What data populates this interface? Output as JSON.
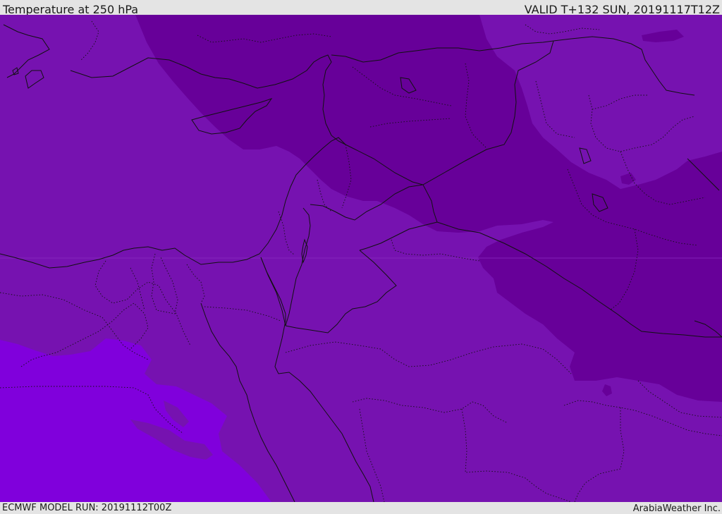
{
  "header": {
    "title": "Temperature at 250 hPa",
    "valid_time": "VALID T+132 SUN, 20191117T12Z"
  },
  "footer": {
    "model_run": "ECMWF MODEL RUN: 20191112T00Z",
    "credit": "ArabiaWeather Inc."
  },
  "map": {
    "field": "temperature",
    "level": "250 hPa",
    "colors": {
      "cold_band": "#670099",
      "mid_band": "#7612b0",
      "warm_band": "#8000dc",
      "coastline": "#111111",
      "border": "#111111"
    }
  }
}
